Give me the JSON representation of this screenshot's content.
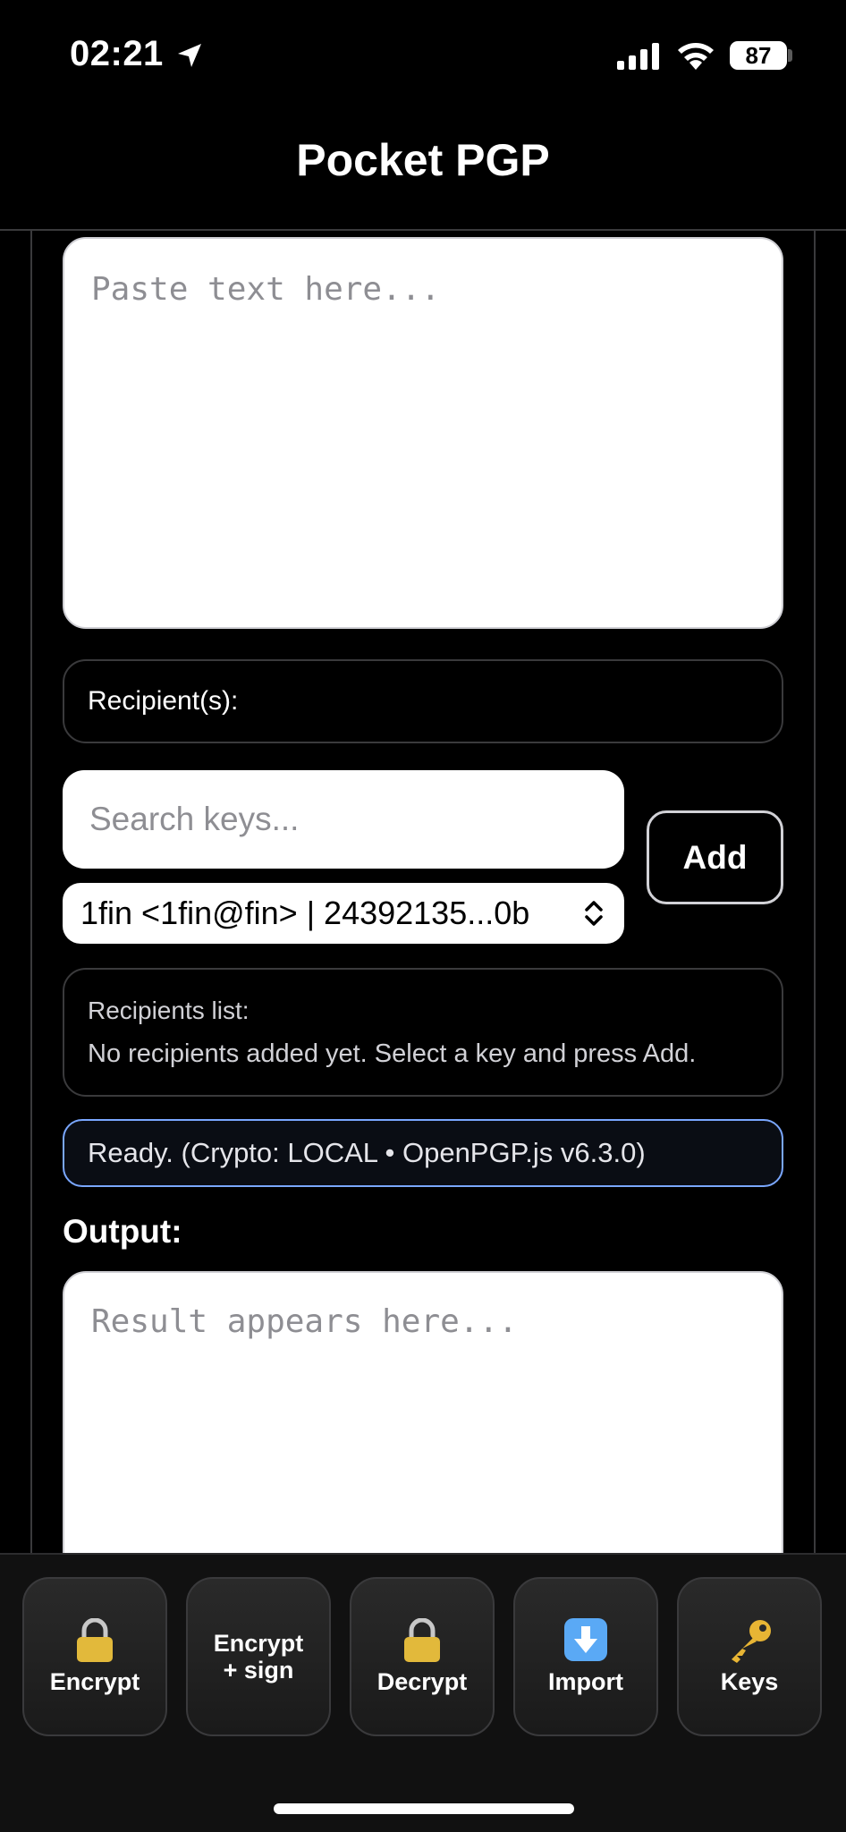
{
  "status_bar": {
    "time": "02:21",
    "battery": "87"
  },
  "header": {
    "title": "Pocket PGP"
  },
  "input": {
    "placeholder": "Paste text here..."
  },
  "recipients": {
    "label": "Recipient(s):",
    "search_placeholder": "Search keys...",
    "selected_key": "1fin <1fin@fin> | 24392135...0b",
    "add_label": "Add",
    "list_title": "Recipients list:",
    "list_empty": "No recipients added yet. Select a key and press Add."
  },
  "status": {
    "message": "Ready. (Crypto: LOCAL • OpenPGP.js v6.3.0)"
  },
  "output": {
    "label": "Output:",
    "placeholder": "Result appears here..."
  },
  "toolbar": {
    "encrypt": {
      "label": "Encrypt",
      "icon": "lock-icon"
    },
    "encrypt_sign": {
      "line1": "Encrypt",
      "line2": "+ sign"
    },
    "decrypt": {
      "label": "Decrypt",
      "icon": "lock-icon"
    },
    "import": {
      "label": "Import",
      "icon": "download-arrow-icon"
    },
    "keys": {
      "label": "Keys",
      "icon": "key-icon"
    }
  },
  "colors": {
    "status_border": "#7aa7ff",
    "background": "#000000"
  }
}
